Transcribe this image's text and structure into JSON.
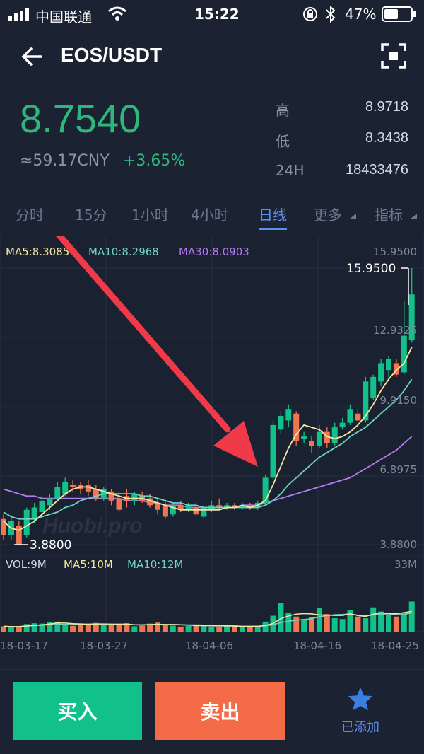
{
  "status_bar": {
    "carrier": "中国联通",
    "time": "15:22",
    "battery": "47%"
  },
  "header": {
    "title": "EOS/USDT",
    "back_icon": "arrow-left-icon",
    "fullscreen_icon": "fullscreen-icon"
  },
  "ticker": {
    "price": "8.7540",
    "cny": "≈59.17CNY",
    "change": "+3.65%",
    "stats": [
      {
        "label": "高",
        "value": "8.9718"
      },
      {
        "label": "低",
        "value": "8.3438"
      },
      {
        "label": "24H",
        "value": "18433476"
      }
    ]
  },
  "tabs": [
    {
      "label": "分时"
    },
    {
      "label": "15分"
    },
    {
      "label": "1小时"
    },
    {
      "label": "4小时"
    },
    {
      "label": "日线",
      "active": true
    },
    {
      "label": "更多"
    },
    {
      "label": "指标"
    }
  ],
  "chart_data": {
    "type": "candlestick",
    "legend": {
      "ma5": "MA5:8.3085",
      "ma10": "MA10:8.2968",
      "ma30": "MA30:8.0903"
    },
    "price_axis": [
      "15.9500",
      "12.9325",
      "9.9150",
      "6.8975",
      "3.8800"
    ],
    "high_label": "15.9500",
    "low_label": "3.8800",
    "volume_legend": {
      "vol": "VOL:9M",
      "ma5": "MA5:10M",
      "ma10": "MA10:12M"
    },
    "volume_max": "33M",
    "x_labels": [
      "18-03-17",
      "18-03-27",
      "18-04-06",
      "18-04-16",
      "18-04-25"
    ],
    "watermark": "Huobi.pro",
    "up_color": "#12c18a",
    "down_color": "#f07550",
    "ma5_color": "#f5e6a0",
    "ma10_color": "#6fd3c0",
    "ma30_color": "#b47cf0",
    "candles": [
      [
        5.0,
        4.3,
        5.2,
        4.1
      ],
      [
        4.3,
        4.9,
        5.1,
        4.1
      ],
      [
        4.7,
        3.9,
        4.9,
        3.9
      ],
      [
        4.3,
        5.4,
        5.5,
        4.2
      ],
      [
        5.0,
        5.5,
        5.7,
        4.8
      ],
      [
        5.3,
        5.8,
        6.0,
        5.1
      ],
      [
        5.6,
        5.9,
        6.1,
        5.4
      ],
      [
        5.9,
        6.4,
        6.6,
        5.8
      ],
      [
        6.1,
        6.6,
        6.8,
        6.0
      ],
      [
        6.5,
        6.4,
        6.7,
        6.2
      ],
      [
        6.5,
        6.3,
        6.6,
        6.1
      ],
      [
        6.5,
        6.2,
        6.7,
        6.0
      ],
      [
        6.3,
        5.9,
        6.5,
        5.8
      ],
      [
        5.9,
        6.3,
        6.4,
        5.8
      ],
      [
        6.2,
        5.8,
        6.3,
        5.6
      ],
      [
        5.9,
        5.4,
        6.2,
        5.3
      ],
      [
        6.0,
        5.8,
        6.3,
        5.5
      ],
      [
        5.8,
        6.1,
        6.2,
        5.6
      ],
      [
        6.0,
        5.8,
        6.2,
        5.7
      ],
      [
        5.9,
        5.6,
        6.1,
        5.5
      ],
      [
        5.7,
        5.4,
        5.9,
        5.2
      ],
      [
        5.6,
        5.1,
        5.8,
        5.0
      ],
      [
        5.2,
        5.6,
        5.7,
        5.1
      ],
      [
        5.6,
        5.4,
        5.8,
        5.3
      ],
      [
        5.4,
        5.6,
        5.7,
        5.3
      ],
      [
        5.5,
        5.2,
        5.7,
        5.1
      ],
      [
        5.1,
        5.5,
        5.6,
        5.0
      ],
      [
        5.4,
        5.6,
        5.8,
        5.3
      ],
      [
        5.6,
        5.5,
        5.9,
        5.4
      ],
      [
        5.5,
        5.6,
        5.7,
        5.4
      ],
      [
        5.6,
        5.5,
        5.7,
        5.4
      ],
      [
        5.5,
        5.6,
        5.7,
        5.4
      ],
      [
        5.6,
        5.5,
        5.7,
        5.4
      ],
      [
        5.5,
        5.7,
        5.8,
        5.4
      ],
      [
        5.7,
        6.8,
        6.9,
        5.6
      ],
      [
        6.8,
        9.1,
        9.3,
        6.7
      ],
      [
        8.9,
        9.5,
        9.7,
        8.7
      ],
      [
        9.3,
        9.8,
        10.0,
        9.0
      ],
      [
        9.6,
        8.4,
        9.7,
        8.2
      ],
      [
        8.5,
        8.6,
        8.8,
        8.3
      ],
      [
        8.4,
        8.2,
        8.6,
        7.9
      ],
      [
        8.2,
        8.8,
        9.1,
        8.1
      ],
      [
        8.8,
        8.3,
        9.0,
        8.1
      ],
      [
        8.3,
        9.0,
        9.2,
        8.2
      ],
      [
        9.0,
        9.2,
        9.4,
        8.9
      ],
      [
        9.2,
        9.8,
        10.0,
        9.1
      ],
      [
        9.6,
        9.3,
        9.8,
        9.2
      ],
      [
        9.3,
        11.0,
        11.2,
        9.2
      ],
      [
        10.3,
        11.2,
        11.3,
        10.2
      ],
      [
        11.0,
        11.8,
        12.0,
        10.8
      ],
      [
        11.5,
        12.0,
        12.1,
        11.2
      ],
      [
        11.8,
        11.3,
        12.0,
        11.2
      ],
      [
        11.4,
        13.0,
        14.5,
        11.3
      ],
      [
        12.8,
        14.8,
        15.95,
        12.7
      ]
    ],
    "volumes": [
      3.2,
      2.8,
      3.0,
      4.5,
      5.0,
      4.8,
      5.5,
      6.0,
      4.2,
      3.5,
      3.8,
      4.6,
      5.2,
      4.0,
      3.8,
      4.4,
      5.0,
      3.2,
      3.6,
      4.8,
      5.4,
      4.0,
      3.6,
      3.0,
      3.4,
      4.2,
      3.8,
      3.0,
      2.8,
      3.6,
      3.2,
      2.6,
      3.0,
      3.4,
      6.0,
      9.5,
      17.0,
      11.0,
      9.0,
      7.5,
      8.5,
      14.0,
      10.5,
      8.0,
      7.5,
      13.0,
      9.0,
      8.0,
      14.5,
      12.0,
      10.0,
      9.0,
      11.5,
      18.0,
      16.0
    ],
    "ma5": [
      4.9,
      4.6,
      4.5,
      4.7,
      4.9,
      5.2,
      5.5,
      5.8,
      6.1,
      6.3,
      6.4,
      6.4,
      6.3,
      6.2,
      6.1,
      6.0,
      5.9,
      5.9,
      5.9,
      5.8,
      5.7,
      5.6,
      5.5,
      5.4,
      5.4,
      5.4,
      5.4,
      5.4,
      5.4,
      5.5,
      5.5,
      5.6,
      5.5,
      5.6,
      5.8,
      6.5,
      7.3,
      8.1,
      8.7,
      9.1,
      9.0,
      8.9,
      8.6,
      8.5,
      8.6,
      8.8,
      9.1,
      9.5,
      10.0,
      10.6,
      11.1,
      11.5,
      11.8,
      12.5
    ],
    "ma10": [
      5.3,
      5.1,
      5.0,
      5.0,
      5.0,
      5.1,
      5.2,
      5.3,
      5.5,
      5.6,
      5.8,
      5.9,
      6.0,
      6.1,
      6.1,
      6.1,
      6.1,
      6.1,
      6.0,
      6.0,
      5.9,
      5.8,
      5.7,
      5.7,
      5.6,
      5.6,
      5.5,
      5.5,
      5.5,
      5.5,
      5.5,
      5.5,
      5.5,
      5.5,
      5.6,
      5.8,
      6.1,
      6.5,
      6.8,
      7.1,
      7.4,
      7.7,
      7.9,
      8.1,
      8.3,
      8.6,
      8.8,
      9.0,
      9.3,
      9.6,
      9.9,
      10.2,
      10.6,
      11.1
    ],
    "ma30": [
      6.3,
      6.2,
      6.1,
      6.0,
      6.0,
      5.9,
      5.9,
      5.9,
      5.9,
      5.9,
      5.9,
      5.9,
      5.9,
      5.9,
      5.9,
      5.9,
      5.8,
      5.8,
      5.8,
      5.7,
      5.7,
      5.6,
      5.6,
      5.6,
      5.5,
      5.5,
      5.5,
      5.5,
      5.5,
      5.5,
      5.5,
      5.6,
      5.6,
      5.6,
      5.7,
      5.8,
      5.9,
      6.0,
      6.1,
      6.2,
      6.3,
      6.4,
      6.5,
      6.6,
      6.7,
      6.8,
      7.0,
      7.2,
      7.4,
      7.6,
      7.8,
      8.0,
      8.3,
      8.6
    ]
  },
  "annotation": {
    "arrow_color": "#f03a4a"
  },
  "trade": {
    "buy": "买入",
    "sell": "卖出",
    "favorite": "已添加",
    "favorite_icon": "star-icon"
  }
}
